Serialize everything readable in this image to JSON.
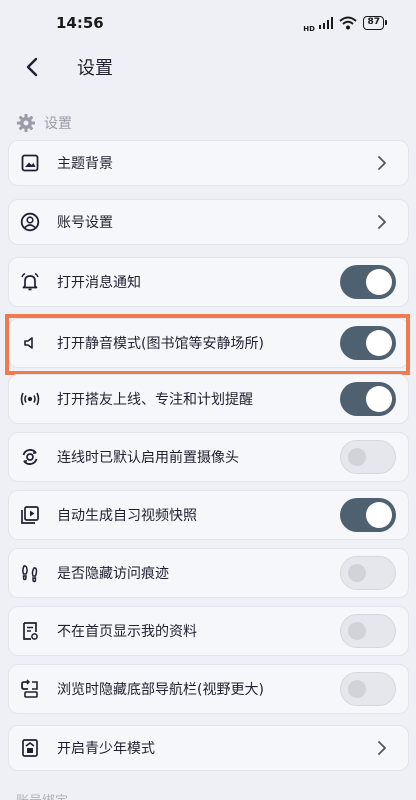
{
  "status_bar": {
    "time": "14:56",
    "network": "HD",
    "battery": "87"
  },
  "header": {
    "title": "设置"
  },
  "section": {
    "title": "设置"
  },
  "items": [
    {
      "label": "主题背景",
      "type": "link",
      "icon": "image-icon"
    },
    {
      "label": "账号设置",
      "type": "link",
      "icon": "user-circle-icon"
    },
    {
      "label": "打开消息通知",
      "type": "toggle",
      "state": "on",
      "icon": "bell-icon"
    },
    {
      "label": "打开静音模式(图书馆等安静场所)",
      "type": "toggle",
      "state": "on",
      "icon": "speaker-icon"
    },
    {
      "label": "打开搭友上线、专注和计划提醒",
      "type": "toggle",
      "state": "on",
      "icon": "broadcast-icon"
    },
    {
      "label": "连线时已默认启用前置摄像头",
      "type": "toggle",
      "state": "off",
      "icon": "camera-switch-icon"
    },
    {
      "label": "自动生成自习视频快照",
      "type": "toggle",
      "state": "on",
      "icon": "video-snapshot-icon"
    },
    {
      "label": "是否隐藏访问痕迹",
      "type": "toggle",
      "state": "off",
      "icon": "footprints-icon"
    },
    {
      "label": "不在首页显示我的资料",
      "type": "toggle",
      "state": "off",
      "icon": "document-icon"
    },
    {
      "label": "浏览时隐藏底部导航栏(视野更大)",
      "type": "toggle",
      "state": "off",
      "icon": "nav-bar-icon"
    },
    {
      "label": "开启青少年模式",
      "type": "link",
      "icon": "teen-mode-icon"
    }
  ],
  "next_section_partial": "账号绑定",
  "colors": {
    "toggle_on": "#4f6170",
    "toggle_off": "#e6e7ec",
    "highlight": "#ef7a4d",
    "background": "#eef0f6"
  }
}
